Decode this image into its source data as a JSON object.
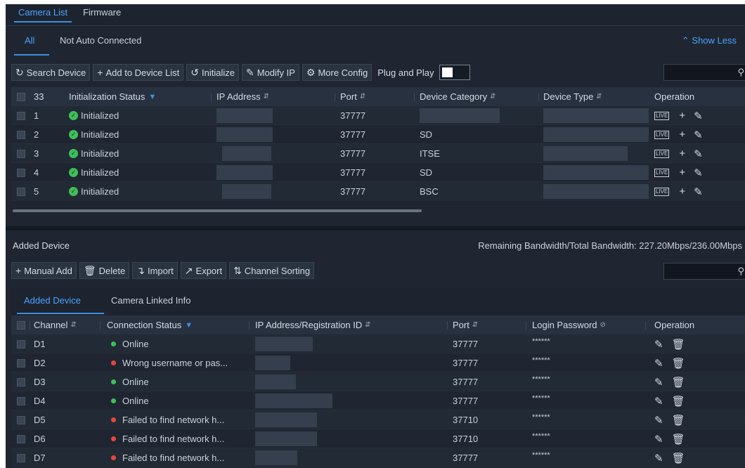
{
  "top_tabs": [
    "Camera List",
    "Firmware"
  ],
  "filter_tabs": [
    "All",
    "Not Auto Connected"
  ],
  "show_less": "Show Less",
  "toolbar": {
    "search_device": "Search Device",
    "add_to_list": "Add to Device List",
    "initialize": "Initialize",
    "modify_ip": "Modify IP",
    "more_config": "More Config",
    "plug_and_play": "Plug and Play",
    "plug_and_play_on": false
  },
  "camera_table": {
    "headers": {
      "count": "33",
      "init_status": "Initialization Status",
      "ip": "IP Address",
      "port": "Port",
      "category": "Device Category",
      "type": "Device Type",
      "operation": "Operation"
    },
    "rows": [
      {
        "no": "1",
        "status": "Initialized",
        "port": "37777",
        "category": ""
      },
      {
        "no": "2",
        "status": "Initialized",
        "port": "37777",
        "category": "SD"
      },
      {
        "no": "3",
        "status": "Initialized",
        "port": "37777",
        "category": "ITSE"
      },
      {
        "no": "4",
        "status": "Initialized",
        "port": "37777",
        "category": "SD"
      },
      {
        "no": "5",
        "status": "Initialized",
        "port": "37777",
        "category": "BSC"
      }
    ]
  },
  "added": {
    "title": "Added Device",
    "bandwidth": "Remaining Bandwidth/Total Bandwidth:  227.20Mbps/236.00Mbps",
    "toolbar": {
      "manual_add": "Manual Add",
      "delete": "Delete",
      "import": "Import",
      "export": "Export",
      "channel_sorting": "Channel Sorting"
    },
    "tabs": [
      "Added Device",
      "Camera Linked Info"
    ],
    "headers": {
      "channel": "Channel",
      "conn_status": "Connection Status",
      "ip_reg": "IP Address/Registration ID",
      "port": "Port",
      "password": "Login Password",
      "operation": "Operation"
    },
    "rows": [
      {
        "channel": "D1",
        "status": "Online",
        "state": "ok",
        "port": "37777",
        "password": "******"
      },
      {
        "channel": "D2",
        "status": "Wrong username or pas...",
        "state": "error",
        "port": "37777",
        "password": "******"
      },
      {
        "channel": "D3",
        "status": "Online",
        "state": "ok",
        "port": "37777",
        "password": "******"
      },
      {
        "channel": "D4",
        "status": "Online",
        "state": "ok",
        "port": "37777",
        "password": "******"
      },
      {
        "channel": "D5",
        "status": "Failed to find network h...",
        "state": "error",
        "port": "37710",
        "password": "******"
      },
      {
        "channel": "D6",
        "status": "Failed to find network h...",
        "state": "error",
        "port": "37710",
        "password": "******"
      },
      {
        "channel": "D7",
        "status": "Failed to find network h...",
        "state": "error",
        "port": "37777",
        "password": "******"
      }
    ]
  },
  "colors": {
    "accent": "#4aa3ff",
    "online": "#3fbf5a",
    "error": "#e8463f",
    "background": "#1f2631"
  }
}
